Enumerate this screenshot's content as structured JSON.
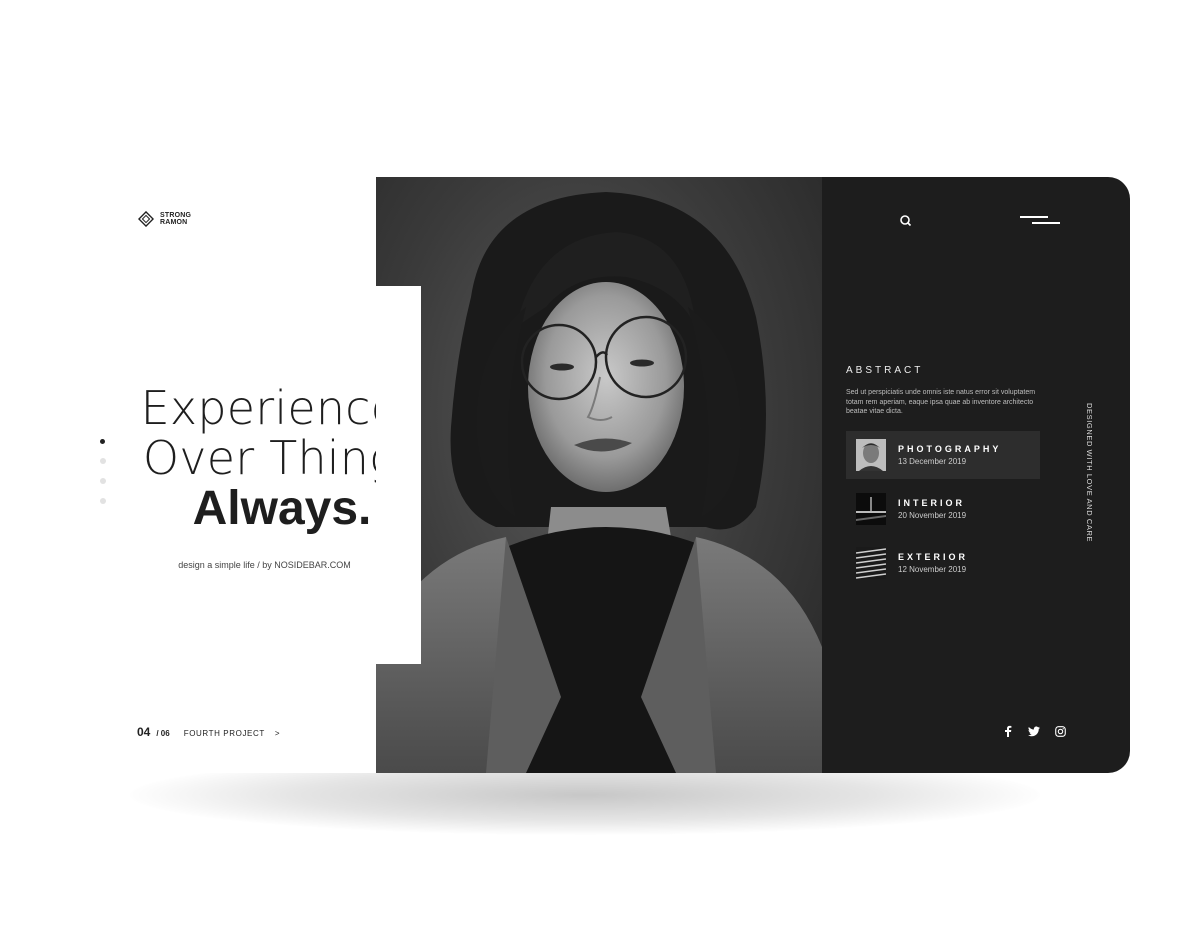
{
  "brand": {
    "logo_line1": "STRONG",
    "logo_line2": "RAMON"
  },
  "hero": {
    "line1": "Experiences",
    "line2": "Over Things",
    "line3": "Always.",
    "tagline": "design a simple life / by NOSIDEBAR.COM"
  },
  "slider": {
    "dots": 4,
    "active_index": 0
  },
  "pager": {
    "current": "04",
    "total": "/ 06",
    "project_label": "FOURTH PROJECT",
    "next_label": ">"
  },
  "header": {
    "search_icon": "search-icon",
    "menu_icon": "menu-icon"
  },
  "sidebar": {
    "abstract_title": "ABSTRACT",
    "abstract_text": "Sed ut perspiciatis unde omnis iste natus error sit voluptatem totam rem aperiam, eaque ipsa quae ab inventore architecto beatae vitae dicta.",
    "items": [
      {
        "title": "PHOTOGRAPHY",
        "date": "13 December 2019",
        "active": true
      },
      {
        "title": "INTERIOR",
        "date": "20 November 2019",
        "active": false
      },
      {
        "title": "EXTERIOR",
        "date": "12 November 2019",
        "active": false
      }
    ],
    "vertical_text": "DESIGNED WITH LOVE AND CARE"
  },
  "social": {
    "facebook": "facebook-icon",
    "twitter": "twitter-icon",
    "instagram": "instagram-icon"
  },
  "colors": {
    "dark_panel": "#1d1d1d",
    "active_item": "#2d2d2d",
    "text_dark": "#1e1e1e"
  }
}
